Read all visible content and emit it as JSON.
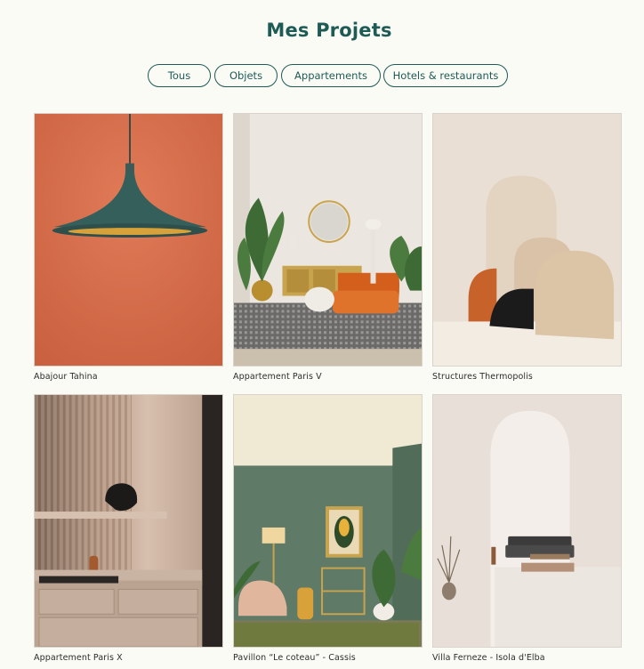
{
  "header": {
    "title": "Mes Projets"
  },
  "filters": [
    {
      "label": "Tous"
    },
    {
      "label": "Objets"
    },
    {
      "label": "Appartements"
    },
    {
      "label": "Hotels & restaurants"
    }
  ],
  "projects": [
    {
      "caption": "Abajour Tahina",
      "image": "orange-wall-pendant-lamp"
    },
    {
      "caption": "Appartement Paris V",
      "image": "living-room-orange-sofa"
    },
    {
      "caption": "Structures Thermopolis",
      "image": "beige-arch-sculptures"
    },
    {
      "caption": "Appartement Paris X",
      "image": "kitchen-wood-panels-lamp"
    },
    {
      "caption": "Pavillon “Le coteau” - Cassis",
      "image": "green-room-pink-chair"
    },
    {
      "caption": "Villa Ferneze - Isola d'Elba",
      "image": "white-arch-grey-sofa"
    }
  ],
  "colors": {
    "accent": "#1e5b55",
    "background": "#fbfbf6"
  }
}
